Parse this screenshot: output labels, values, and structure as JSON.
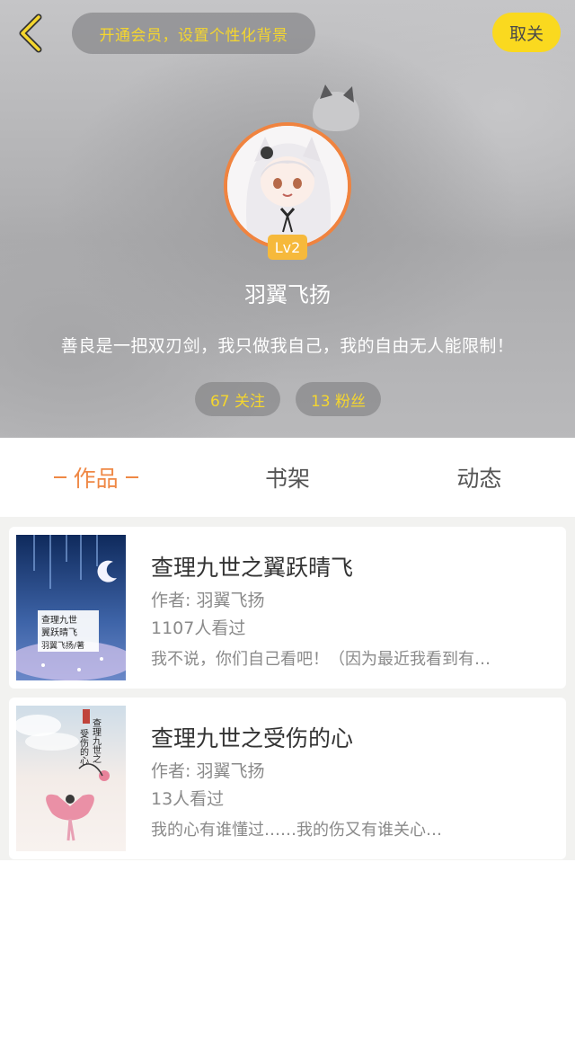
{
  "header": {
    "vip_banner": "开通会员，设置个性化背景",
    "unfollow_label": "取关",
    "level": "Lv2",
    "username": "羽翼飞扬",
    "bio": "善良是一把双刃剑，我只做我自己，我的自由无人能限制！",
    "following": "67 关注",
    "fans": "13 粉丝"
  },
  "tabs": [
    {
      "label": "作品",
      "active": true
    },
    {
      "label": "书架",
      "active": false
    },
    {
      "label": "动态",
      "active": false
    }
  ],
  "books": [
    {
      "title": "查理九世之翼跃晴飞",
      "author": "作者: 羽翼飞扬",
      "views": "1107人看过",
      "description": "我不说，你们自己看吧！（因为最近我看到有…",
      "cover_text": [
        "查理九世",
        "翼跃晴飞",
        "羽翼飞扬/著"
      ]
    },
    {
      "title": "查理九世之受伤的心",
      "author": "作者: 羽翼飞扬",
      "views": "13人看过",
      "description": "我的心有谁懂过……我的伤又有谁关心…",
      "cover_text": [
        "查理九世之",
        "受伤的心"
      ]
    }
  ],
  "colors": {
    "accent_orange": "#ef8845",
    "vip_yellow": "#f5d62e",
    "unfollow_bg": "#fad91f",
    "level_badge": "#f6b93b",
    "avatar_ring": "#f0833f"
  },
  "icons": {
    "back": "chevron-left-icon",
    "decoration": "cat-head-icon"
  }
}
